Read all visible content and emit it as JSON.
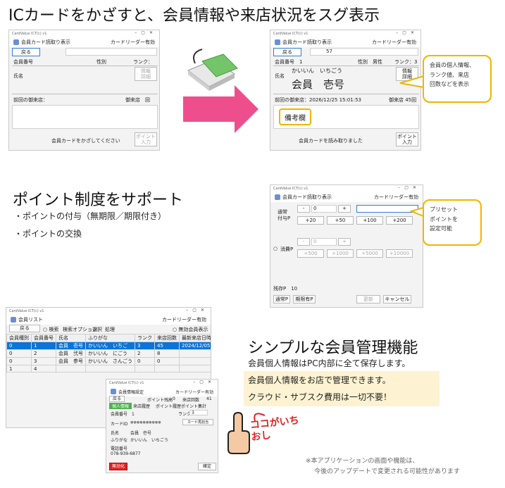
{
  "sec1": {
    "title": "ICカードをかざすと、会員情報や来店状況をスグ表示"
  },
  "w1": {
    "titlebar": "CardValue ICT(c) v1",
    "header": "会員カード読取り表示",
    "reader": "カードリーダー有効",
    "back": "戻る",
    "col_member_no": "会員番号",
    "col_gender": "性別",
    "col_rank": "ランク：",
    "name_label": "氏名",
    "detail_btn": "情報\n詳細",
    "last_visit": "前回の御来店：",
    "visit_count": "御来店　回",
    "status": "会員カードをかざしてください",
    "point_btn": "ポイント\n入力"
  },
  "w2": {
    "titlebar": "CardValue ICT(c) v1",
    "header": "会員カード読取り表示",
    "reader": "カードリーダー有効",
    "back": "戻る",
    "select_value": "57",
    "col_member_no": "会員番号　1",
    "col_gender": "性別　男性",
    "col_rank": "ランク：3",
    "name_label": "氏名",
    "kana": "かいいん　いちごう",
    "name": "会員　壱号",
    "detail_btn": "情報\n詳細",
    "last_visit": "前回の御来店：2026/12/25 15:01:53",
    "visit_count": "御来店 45回",
    "notes": "備考欄",
    "status": "会員カードを読み取りました",
    "point_btn": "ポイント\n入力"
  },
  "bubble1": "会員の個人情報、\nランク値、来店\n回数などを表示",
  "sec2": {
    "title": "ポイント制度をサポート",
    "bullet1": "・ポイントの付与（無期限／期限付き）",
    "bullet2": "・ポイントの交換"
  },
  "w3": {
    "titlebar": "CardValue ICT(c) v1",
    "header": "会員カード読取り表示",
    "reader": "カードリーダー有効",
    "grant_label": "通常\n付与P",
    "minus": "-",
    "grant_value": "0",
    "plus": "+",
    "p20": "+20",
    "p50": "+50",
    "p100": "+100",
    "p200": "+200",
    "use_label": "消費P",
    "use_value": "0",
    "p500": "+500",
    "p1000": "+1000",
    "p5000": "+5000",
    "p10000": "+10000",
    "remain": "残存P　10",
    "normal_btn": "通常P",
    "limited_btn": "期限有P",
    "update_btn": "更新",
    "cancel_btn": "キャンセル"
  },
  "bubble2": "プリセット\nポイントを\n設定可能",
  "w4": {
    "titlebar": "CardValue ICT(c) v1",
    "header": "会員リスト",
    "reader": "カードリーダー有効",
    "back": "戻る",
    "search": "検索",
    "search_opt": "検索オプション",
    "select": "選択",
    "process": "処理",
    "invalid_show": "無効会員表示",
    "columns": [
      "会員種別",
      "会員番号",
      "氏名",
      "ふりがな",
      "ランク",
      "来店回数",
      "最新来店日時"
    ],
    "rows": [
      [
        "0",
        "1",
        "会員　壱号",
        "かいいん　いちご",
        "3",
        "45",
        "2024/12/05 14:41"
      ],
      [
        "0",
        "2",
        "会員　弐号",
        "かいいん　にごう",
        "2",
        "8",
        ""
      ],
      [
        "0",
        "3",
        "会員　参号",
        "かいいん　さんごう",
        "0",
        "0",
        ""
      ],
      [
        "1",
        "4",
        "",
        "",
        "",
        "",
        ""
      ]
    ]
  },
  "w5": {
    "titlebar": "CardValue ICT(c) v1",
    "header": "会員情報設定",
    "reader": "カードリーダー有効",
    "back": "戻る",
    "point_remain": "ポイント残高",
    "point_val": "0",
    "visit_count": "来店回数",
    "visit_val": "41",
    "tab1": "個人情報",
    "tab2": "来店履歴",
    "tab3": "ポイント履歴",
    "tab4": "ポイント集計",
    "member_no": "会員番号　1",
    "rank": "ランク",
    "rank_val": "3",
    "card_id": "カードID",
    "card_id_val": "●●●●●●●●●●",
    "card_reset": "カード再割当",
    "name_label": "氏名",
    "name_val": "会員　壱号",
    "kana_label": "ふりがな",
    "kana_val": "かいいん　いちごう",
    "phone_label": "電話番号",
    "phone_val": "078-939-6877",
    "invalidate": "無効化",
    "confirm": "確定"
  },
  "sec3": {
    "title": "シンプルな会員管理機能",
    "line1": "会員個人情報はPC内部に全て保存します。",
    "line2": "会員個人情報をお店で管理できます。",
    "line3": "クラウド・サブスク費用は一切不要！"
  },
  "badge": {
    "text": "ココがいちおし"
  },
  "footnote1": "※本アプリケーションの画面や機能は、",
  "footnote2": "今後のアップデートで変更される可能性があります",
  "colors": {
    "accent_yellow": "#f2b400",
    "arrow_pink": "#ee4f8c",
    "select_blue": "#0a74da",
    "cream": "#fdf3d2",
    "invalidate_red": "#e12121"
  }
}
